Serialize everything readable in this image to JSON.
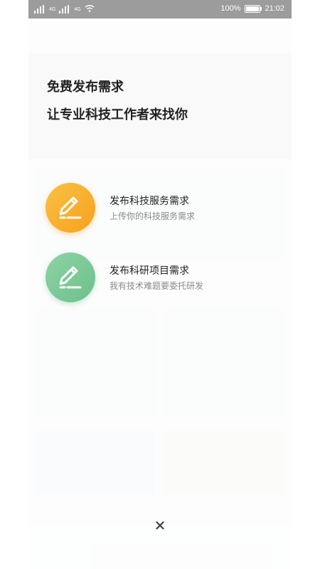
{
  "status_bar": {
    "battery": "100%",
    "time": "21:02",
    "net_1": "4G",
    "net_2": "4G"
  },
  "overlay": {
    "headline_1": "免费发布需求",
    "headline_2": "让专业科技工作者来找你",
    "options": [
      {
        "title": "发布科技服务需求",
        "subtitle": "上传你的科技服务需求",
        "icon": "edit-icon",
        "color": "#F7A11C"
      },
      {
        "title": "发布科研项目需求",
        "subtitle": "我有技术难题要委托研发",
        "icon": "edit-icon",
        "color": "#6CC08B"
      }
    ],
    "close_icon": "close-icon"
  }
}
